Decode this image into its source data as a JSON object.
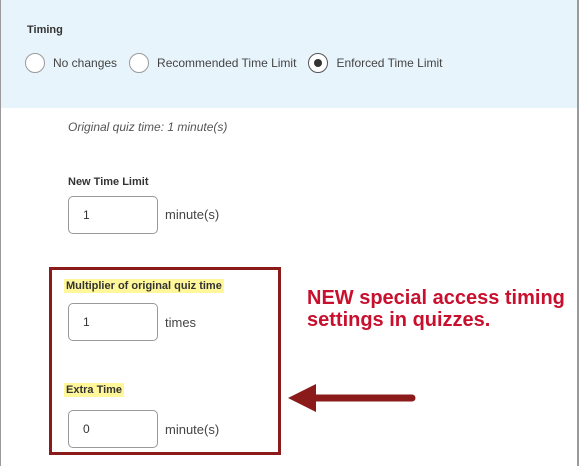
{
  "timing": {
    "label": "Timing",
    "options": [
      {
        "label": "No changes",
        "checked": false
      },
      {
        "label": "Recommended Time Limit",
        "checked": false
      },
      {
        "label": "Enforced Time Limit",
        "checked": true
      }
    ]
  },
  "original_time": "Original quiz time: 1 minute(s)",
  "new_time_limit": {
    "label": "New Time Limit",
    "value": "1",
    "unit": "minute(s)"
  },
  "multiplier": {
    "label": "Multiplier of original quiz time",
    "value": "1",
    "unit": "times"
  },
  "extra_time": {
    "label": "Extra Time",
    "value": "0",
    "unit": "minute(s)"
  },
  "annotation": {
    "text": "NEW special access timing settings in quizzes.",
    "color": "#c8102e"
  },
  "colors": {
    "panel": "#e8f4fb",
    "highlight": "#fff79a",
    "box": "#8b1a1a",
    "arrow": "#8b1a1a"
  }
}
